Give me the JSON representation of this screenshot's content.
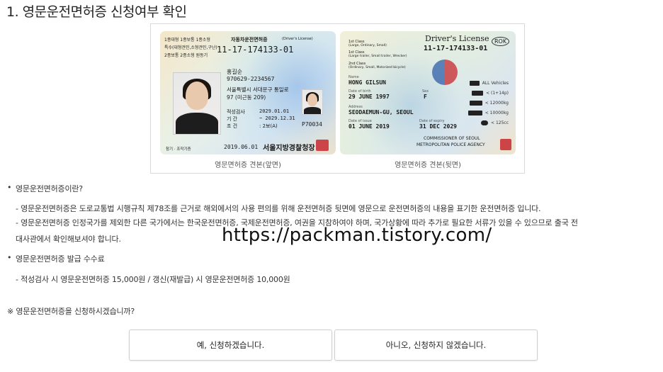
{
  "page": {
    "title": "1. 영문운전면허증 신청여부 확인",
    "watermark": "https://packman.tistory.com/"
  },
  "license_front": {
    "caption": "영문면허증 견본(앞면)",
    "class_line1": "1종대형 1종보통 1종소형",
    "class_line2": "특수(대형견인,소형견인,구난)",
    "class_line3": "2종보통 2종소형 원동기",
    "card_title": "자동차운전면허증",
    "card_title_en": "(Driver's License)",
    "license_number": "11-17-174133-01",
    "name": "홍길순",
    "id_number": "970629-2234567",
    "address1": "서울특별시 서대문구 통일로",
    "address2": "97 (미근동 209)",
    "test_label": "적성검사",
    "test_start": "2029.01.01",
    "period_label": "기    간",
    "test_end": "~ 2029.12.31",
    "condition_label": "조    건",
    "condition_value": ": 2보(A)",
    "code": "P70034",
    "issue_date": "2019.06.01",
    "issuer": "서울지방경찰청장",
    "footer_mark": "참기 · 조작기증"
  },
  "license_back": {
    "caption": "영문면허증 견본(뒷면)",
    "title": "Driver's License",
    "country": "ROK",
    "license_number": "11-17-174133-01",
    "class1_label": "1st Class",
    "class1_desc": "(Large, Ordinary, Small)",
    "class1b_label": "1st Class",
    "class1b_desc": "(Large trailer, Small trailer, Wrecker)",
    "class2_label": "2nd Class",
    "class2_desc": "(Ordinary, Small, Motorized bicycle)",
    "name_label": "Name",
    "name": "HONG GILSUN",
    "dob_label": "Date of birth",
    "dob": "29 JUNE 1997",
    "sex_label": "Sex",
    "sex": "F",
    "address_label": "Address",
    "address": "SEODAEMUN-GU, SEOUL",
    "issue_label": "Date of issue",
    "issue_date": "01 JUNE 2019",
    "expiry_label": "Date of expiry",
    "expiry_date": "31 DEC 2029",
    "issuer_line1": "COMMISSIONER OF SEOUL",
    "issuer_line2": "METROPOLITAN POLICE AGENCY",
    "vehicle_rows": [
      "ALL Vehicles",
      "< (1+14p)",
      "< 12000kg",
      "< 10000kg",
      "< 125cc"
    ]
  },
  "sections": {
    "what_is_title": "영문운전면허증이란?",
    "what_is_line1": "- 영문운전면허증은 도로교통법 시행규칙 제78조를 근거로 해외에서의 사용 편의를 위해 운전면허증 뒷면에 영문으로 운전면허증의 내용을 표기한 운전면허증 입니다.",
    "what_is_line2": "- 영문운전면허증 인정국가를 제외한 다른 국가에서는 한국운전면허증, 국제운전면허증, 여권을 지참하여야 하며, 국가상황에 따라 추가로 필요한 서류가 있을 수 있으므로 출국 전",
    "what_is_line3": "대사관에서 확인해보셔야 합니다.",
    "fee_title": "영문운전면허증 발급 수수료",
    "fee_line": "- 적성검사 시 영문운전면허증 15,000원 / 갱신(재발급) 시 영문운전면허증 10,000원",
    "question": "※ 영문운전면허증을 신청하시겠습니까?"
  },
  "buttons": {
    "yes": "예, 신청하겠습니다.",
    "no": "아니오, 신청하지 않겠습니다."
  },
  "icons": {
    "bullet": "•"
  },
  "colors": {
    "stamp_red": "#c8282d",
    "button_border": "#cfcfcf"
  }
}
